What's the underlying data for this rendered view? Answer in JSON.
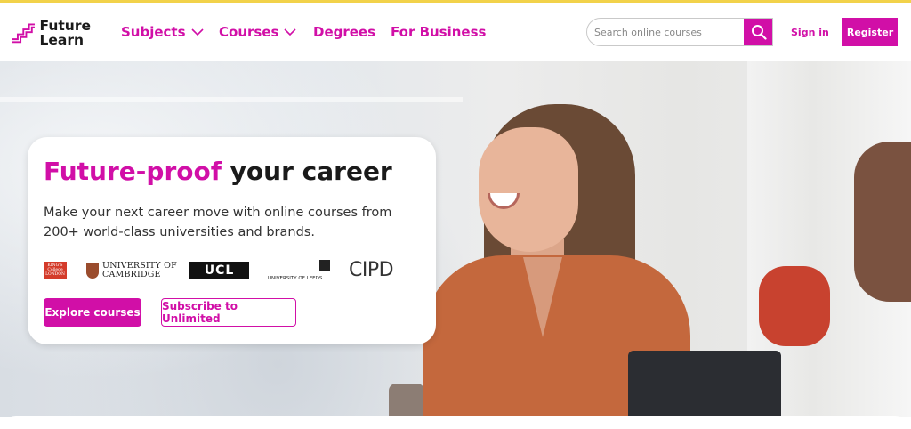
{
  "colors": {
    "accent": "#d10fa7",
    "top_bar": "#f2d24a",
    "text": "#1a1a1a"
  },
  "logo": {
    "line1": "Future",
    "line2": "Learn",
    "icon": "futurelearn-stairs-logo"
  },
  "nav": {
    "subjects": "Subjects",
    "courses": "Courses",
    "degrees": "Degrees",
    "business": "For Business"
  },
  "search": {
    "placeholder": "Search online courses",
    "value": "",
    "icon": "search-icon"
  },
  "auth": {
    "sign_in": "Sign in",
    "register": "Register"
  },
  "hero": {
    "title_accent": "Future-proof",
    "title_rest": " your career",
    "subtitle": "Make your next career move with online courses from 200+ world-class universities and brands.",
    "partners": {
      "kings": "KING'S College LONDON",
      "cambridge_line1": "UNIVERSITY OF",
      "cambridge_line2": "CAMBRIDGE",
      "ucl": "UCL",
      "leeds": "UNIVERSITY OF LEEDS",
      "cipd": "CIPD"
    },
    "explore_button": "Explore courses",
    "subscribe_button": "Subscribe to Unlimited"
  }
}
